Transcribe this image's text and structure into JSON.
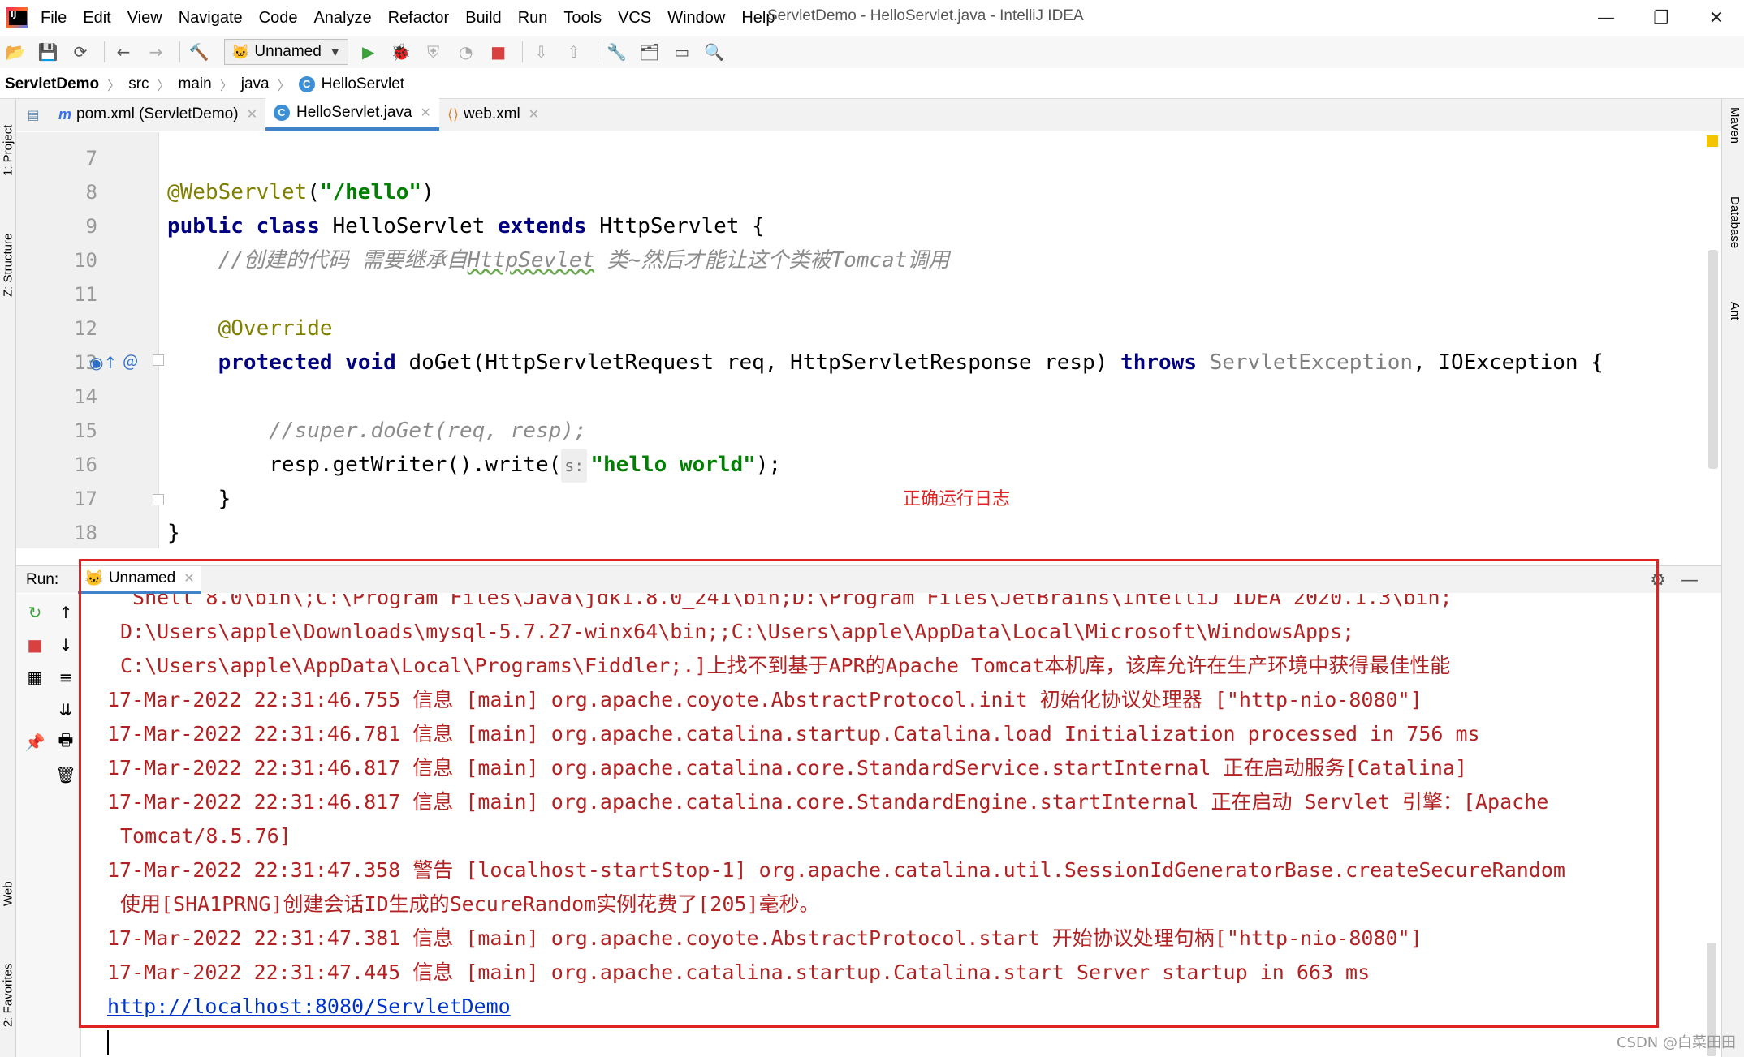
{
  "window": {
    "title": "ServletDemo - HelloServlet.java - IntelliJ IDEA",
    "controls": [
      "—",
      "❐",
      "✕"
    ]
  },
  "menu": [
    "File",
    "Edit",
    "View",
    "Navigate",
    "Code",
    "Analyze",
    "Refactor",
    "Build",
    "Run",
    "Tools",
    "VCS",
    "Window",
    "Help"
  ],
  "toolbar": {
    "run_config": "Unnamed"
  },
  "breadcrumb": [
    "ServletDemo",
    "src",
    "main",
    "java",
    "HelloServlet"
  ],
  "left_tabs": [
    "1: Project",
    "Z: Structure",
    "Web",
    "2: Favorites"
  ],
  "right_tabs": [
    "Maven",
    "Database",
    "Ant"
  ],
  "editor_tabs": [
    {
      "label": "pom.xml (ServletDemo)",
      "icon": "maven-icon",
      "active": false
    },
    {
      "label": "HelloServlet.java",
      "icon": "class-icon",
      "active": true
    },
    {
      "label": "web.xml",
      "icon": "xml-icon",
      "active": false
    }
  ],
  "editor": {
    "line_numbers": [
      "7",
      "8",
      "9",
      "10",
      "11",
      "12",
      "13",
      "14",
      "15",
      "16",
      "17",
      "18"
    ],
    "l8_ann": "@WebServlet",
    "l8_p1": "(",
    "l8_str": "\"/hello\"",
    "l8_p2": ")",
    "l9_kw1": "public",
    "l9_kw2": "class",
    "l9_name": "HelloServlet",
    "l9_kw3": "extends",
    "l9_super": "HttpServlet {",
    "l10_comment_a": "//创建的代码 需要继承自",
    "l10_comment_b": "HttpSevlet",
    "l10_comment_c": " 类~然后才能让这个类被Tomcat调用",
    "l12_ann": "@Override",
    "l13_kw1": "protected",
    "l13_kw2": "void",
    "l13_sig": "doGet(HttpServletRequest req, HttpServletResponse resp)",
    "l13_throws": "throws",
    "l13_ex1": "ServletException",
    "l13_rest": ", IOException {",
    "l15_comment": "//super.doGet(req, resp);",
    "l16_call": "resp.getWriter().write(",
    "l16_hint": "s:",
    "l16_str": "\"hello world\"",
    "l16_end": ");",
    "l17": "}",
    "l18": "}"
  },
  "annotation_note": "正确运行日志",
  "run": {
    "label": "Run:",
    "tab": "Unnamed",
    "log_lines": [
      " Shell 8.0\\bin\\;C:\\Program Files\\Java\\jdk1.8.0_241\\bin;D:\\Program Files\\JetBrains\\IntelliJ IDEA 2020.1.3\\bin;",
      "D:\\Users\\apple\\Downloads\\mysql-5.7.27-winx64\\bin;;C:\\Users\\apple\\AppData\\Local\\Microsoft\\WindowsApps;",
      "C:\\Users\\apple\\AppData\\Local\\Programs\\Fiddler;.]上找不到基于APR的Apache Tomcat本机库，该库允许在生产环境中获得最佳性能",
      "17-Mar-2022 22:31:46.755 信息 [main] org.apache.coyote.AbstractProtocol.init 初始化协议处理器 [\"http-nio-8080\"]",
      "17-Mar-2022 22:31:46.781 信息 [main] org.apache.catalina.startup.Catalina.load Initialization processed in 756 ms",
      "17-Mar-2022 22:31:46.817 信息 [main] org.apache.catalina.core.StandardService.startInternal 正在启动服务[Catalina]",
      "17-Mar-2022 22:31:46.817 信息 [main] org.apache.catalina.core.StandardEngine.startInternal 正在启动 Servlet 引擎：[Apache",
      "Tomcat/8.5.76]",
      "17-Mar-2022 22:31:47.358 警告 [localhost-startStop-1] org.apache.catalina.util.SessionIdGeneratorBase.createSecureRandom",
      "使用[SHA1PRNG]创建会话ID生成的SecureRandom实例花费了[205]毫秒。",
      "17-Mar-2022 22:31:47.381 信息 [main] org.apache.coyote.AbstractProtocol.start 开始协议处理句柄[\"http-nio-8080\"]",
      "17-Mar-2022 22:31:47.445 信息 [main] org.apache.catalina.startup.Catalina.start Server startup in 663 ms"
    ],
    "link": "http://localhost:8080/ServletDemo"
  },
  "watermark": "CSDN @白菜田田",
  "colors": {
    "keyword": "#000080",
    "annotation": "#808000",
    "string": "#008000",
    "comment": "#8c8c8c",
    "log": "#b22222",
    "highlight_box": "#e02222",
    "active_tab": "#4083c9"
  }
}
